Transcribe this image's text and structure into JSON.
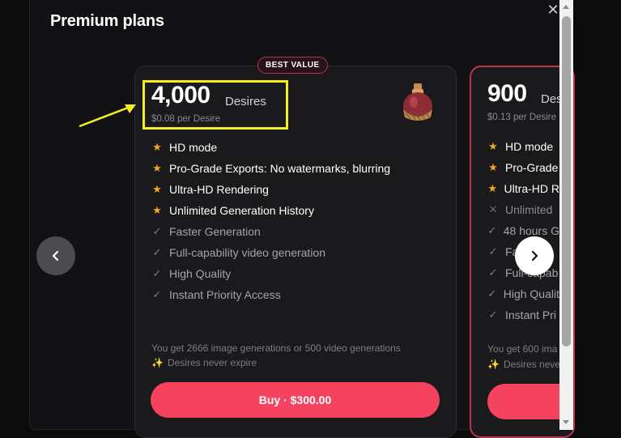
{
  "modal": {
    "title": "Premium plans",
    "close_icon": "close-icon"
  },
  "plan1": {
    "badge": "BEST VALUE",
    "amount": "4,000",
    "unit": "Desires",
    "per": "$0.08 per Desire",
    "image": "potion-bottle-icon",
    "features": [
      {
        "icon": "star-icon",
        "text": "HD mode"
      },
      {
        "icon": "star-icon",
        "text": "Pro-Grade Exports: No watermarks, blurring"
      },
      {
        "icon": "star-icon",
        "text": "Ultra-HD Rendering"
      },
      {
        "icon": "star-icon",
        "text": "Unlimited Generation History"
      },
      {
        "icon": "check-icon",
        "text": "Faster Generation"
      },
      {
        "icon": "check-icon",
        "text": "Full-capability video generation"
      },
      {
        "icon": "check-icon",
        "text": "High Quality"
      },
      {
        "icon": "check-icon",
        "text": "Instant Priority Access"
      }
    ],
    "gen_note": "You get 2666 image generations or 500 video generations",
    "expire_note": "Desires never expire",
    "buy_label": "Buy · $300.00"
  },
  "plan2": {
    "amount": "900",
    "unit": "Des",
    "per": "$0.13 per Desire",
    "features": [
      {
        "icon": "star-icon",
        "text": "HD mode"
      },
      {
        "icon": "star-icon",
        "text": "Pro-Grade"
      },
      {
        "icon": "star-icon",
        "text": "Ultra-HD R"
      },
      {
        "icon": "cross-icon",
        "text": "Unlimited"
      },
      {
        "icon": "check-icon",
        "text": "48 hours G"
      },
      {
        "icon": "check-icon",
        "text": "Fa"
      },
      {
        "icon": "check-icon",
        "text": "Full-capab"
      },
      {
        "icon": "check-icon",
        "text": "High Qualit"
      },
      {
        "icon": "check-icon",
        "text": "Instant Pri"
      }
    ],
    "gen_note": "You get 600 ima",
    "expire_note": "Desires neve"
  },
  "nav": {
    "prev_icon": "chevron-left-icon",
    "next_icon": "chevron-right-icon"
  },
  "colors": {
    "accent": "#f5425f",
    "badge_border": "#a33a4d",
    "star": "#f4a524",
    "annotation": "#f4ee23"
  }
}
